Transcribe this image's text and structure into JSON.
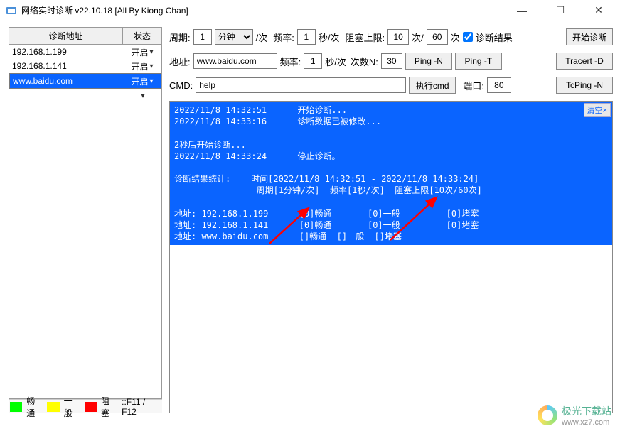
{
  "window": {
    "title": "网络实时诊断 v22.10.18 [All By Kiong Chan]",
    "min_label": "—",
    "max_label": "☐",
    "close_label": "✕"
  },
  "sidebar": {
    "header_addr": "诊断地址",
    "header_state": "状态",
    "rows": [
      {
        "addr": "192.168.1.199",
        "state": "开启",
        "selected": false
      },
      {
        "addr": "192.168.1.141",
        "state": "开启",
        "selected": false
      },
      {
        "addr": "www.baidu.com",
        "state": "开启",
        "selected": true
      },
      {
        "addr": "",
        "state": "",
        "selected": false
      }
    ]
  },
  "legend": {
    "ok": "畅通",
    "mid": "一般",
    "bad": "阻塞",
    "hotkey": "::F11 / F12"
  },
  "form": {
    "period_label": "周期:",
    "period_value": "1",
    "period_unit": "分钟",
    "per_time": "/次",
    "freq_label": "频率:",
    "freq_value": "1",
    "freq_unit": "秒/次",
    "block_label": "阻塞上限:",
    "block_a": "10",
    "block_mid": "次/",
    "block_b": "60",
    "block_suffix": "次",
    "result_check": "诊断结果",
    "start_btn": "开始诊断",
    "addr_label": "地址:",
    "addr_value": "www.baidu.com",
    "freq2_label": "频率:",
    "freq2_value": "1",
    "freq2_unit": "秒/次",
    "countn_label": "次数N:",
    "countn_value": "30",
    "ping_n": "Ping -N",
    "ping_t": "Ping -T",
    "tracert_d": "Tracert -D",
    "cmd_label": "CMD:",
    "cmd_value": "help",
    "exec_btn": "执行cmd",
    "port_label": "端口:",
    "port_value": "80",
    "tcping_n": "TcPing -N"
  },
  "console": {
    "clear": "清空×",
    "text": "2022/11/8 14:32:51      开始诊断...\n2022/11/8 14:33:16      诊断数据已被修改...\n\n2秒后开始诊断...\n2022/11/8 14:33:24      停止诊断。\n\n诊断结果统计:    时间[2022/11/8 14:32:51 - 2022/11/8 14:33:24]\n                周期[1分钟/次]  频率[1秒/次]  阻塞上限[10次/60次]\n\n地址: 192.168.1.199      [0]畅通       [0]一般         [0]堵塞\n地址: 192.168.1.141      [0]畅通       [0]一般         [0]堵塞\n地址: www.baidu.com      []畅通  []一般  []堵塞"
  },
  "watermark": {
    "name": "极光下载站",
    "url": "www.xz7.com"
  }
}
